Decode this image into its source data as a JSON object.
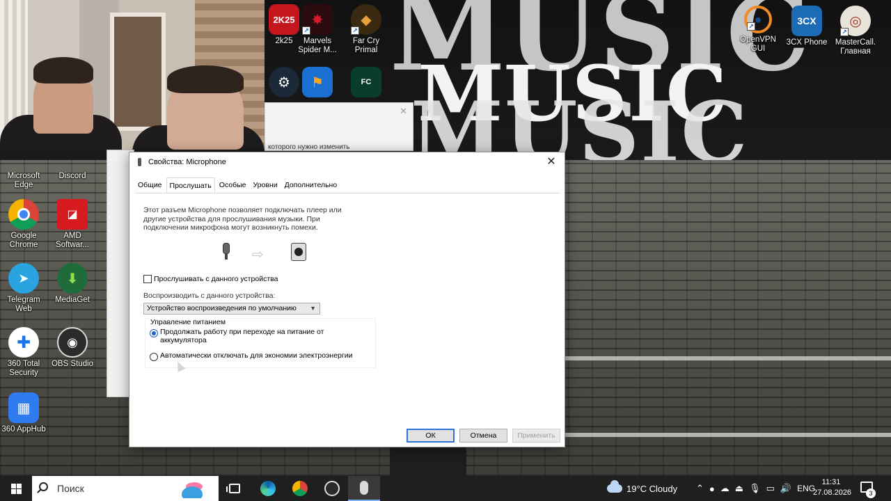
{
  "desktop": {
    "icons_left": [
      {
        "label": "Microsoft Edge"
      },
      {
        "label": "Discord"
      },
      {
        "label": "Google Chrome"
      },
      {
        "label": "AMD Softwar..."
      },
      {
        "label": "Telegram Web"
      },
      {
        "label": "MediaGet"
      },
      {
        "label": "360 Total Security"
      },
      {
        "label": "OBS Studio"
      },
      {
        "label": "360 AppHub"
      }
    ],
    "icons_top": [
      {
        "label": "2k25"
      },
      {
        "label": "Marvels Spider M..."
      },
      {
        "label": "Far Cry Primal"
      },
      {
        "label": "OpenVPN GUI"
      },
      {
        "label": "3CX Phone"
      },
      {
        "label": "MasterCall. Главная"
      }
    ],
    "icon_badges": {
      "twok": "2K25",
      "threecx": "3CX"
    },
    "wallpaper_text": {
      "line1": "MUSIC",
      "line2": "MUSIC",
      "line3": "MUSIC"
    }
  },
  "background_window": {
    "partial_text": "которого нужно изменить"
  },
  "dialog": {
    "title": "Свойства: Microphone",
    "close_glyph": "✕",
    "tabs": [
      "Общие",
      "Прослушать",
      "Особые",
      "Уровни",
      "Дополнительно"
    ],
    "active_tab": "Прослушать",
    "description": "Этот разъем Microphone позволяет подключать плеер или другие устройства для прослушивания музыки. При подключении микрофона могут возникнуть помехи.",
    "listen_checkbox_label": "Прослушивать с данного устройства",
    "listen_checked": false,
    "playback_label": "Воспроизводить с данного устройства:",
    "playback_device": "Устройство воспроизведения по умолчанию",
    "power_group_title": "Управление питанием",
    "power_options": [
      {
        "label": "Продолжать работу при переходе на питание от аккумулятора",
        "selected": true
      },
      {
        "label": "Автоматически отключать для экономии электроэнергии",
        "selected": false
      }
    ],
    "buttons": {
      "ok": "ОК",
      "cancel": "Отмена",
      "apply": "Применить"
    }
  },
  "taskbar": {
    "search_placeholder": "Поиск",
    "weather": "19°C  Cloudy",
    "language": "ENG",
    "time": "11:31",
    "date": "27.08.2026",
    "notification_count": "3"
  },
  "colors": {
    "accent": "#1f5fc9",
    "taskbar": "#1f1f1f",
    "dialog_bg": "#ffffff"
  }
}
